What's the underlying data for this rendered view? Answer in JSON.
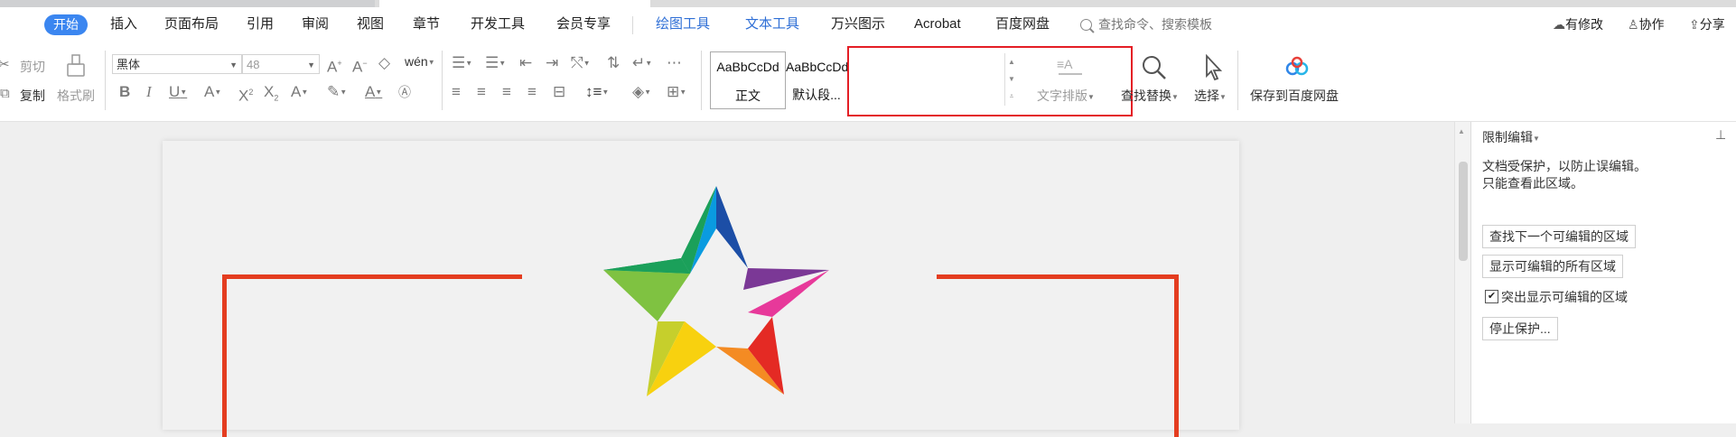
{
  "menu": {
    "tabs": [
      "开始",
      "插入",
      "页面布局",
      "引用",
      "审阅",
      "视图",
      "章节",
      "开发工具",
      "会员专享"
    ],
    "context_tabs": [
      "绘图工具",
      "文本工具",
      "万兴图示",
      "Acrobat",
      "百度网盘"
    ],
    "search_placeholder": "查找命令、搜索模板",
    "right": {
      "modify": "有修改",
      "collab": "协作",
      "share": "分享"
    }
  },
  "ribbon": {
    "cut": "剪切",
    "copy": "复制",
    "format_painter": "格式刷",
    "font_name": "黑体",
    "font_size": "48",
    "styles": {
      "sample": "AaBbCcDd",
      "style1": "正文",
      "style2": "默认段..."
    },
    "text_layout": "文字排版",
    "find_replace": "查找替换",
    "select": "选择",
    "save_baidu": "保存到百度网盘"
  },
  "panel": {
    "title": "限制编辑",
    "desc_line1": "文档受保护，以防止误编辑。",
    "desc_line2": "只能查看此区域。",
    "btn_find_next": "查找下一个可编辑的区域",
    "btn_show_all": "显示可编辑的所有区域",
    "checkbox_label": "突出显示可编辑的区域",
    "checkbox_checked": true,
    "btn_stop": "停止保护..."
  },
  "colors": {
    "accent": "#3b86f0",
    "highlight_red": "#e41e25",
    "frame_red": "#e43d20"
  }
}
